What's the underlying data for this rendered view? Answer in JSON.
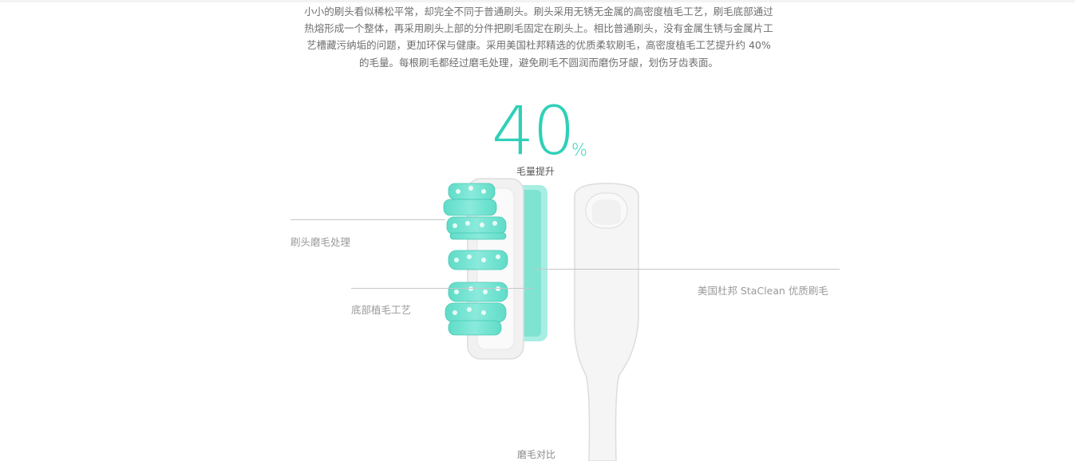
{
  "description": "小小的刷头看似稀松平常，却完全不同于普通刷头。刷头采用无锈无金属的高密度植毛工艺，刷毛底部通过热熔形成一个整体，再采用刷头上部的分件把刷毛固定在刷头上。相比普通刷头，没有金属生锈与金属片工艺槽藏污纳垢的问题，更加环保与健康。采用美国杜邦精选的优质柔软刷毛，高密度植毛工艺提升约 40% 的毛量。每根刷毛都经过磨毛处理，避免刷毛不圆润而磨伤牙龈，划伤牙齿表面。",
  "stat": {
    "value": "40",
    "unit": "%",
    "label": "毛量提升"
  },
  "callouts": {
    "left_top": "刷头磨毛处理",
    "left_bottom": "底部植毛工艺",
    "right": "美国杜邦 StaClean 优质刷毛"
  },
  "bottom_label": "磨毛对比",
  "colors": {
    "accent": "#2fd0b8",
    "bristle": "#7fe6d6",
    "head": "#f2f2f2"
  }
}
